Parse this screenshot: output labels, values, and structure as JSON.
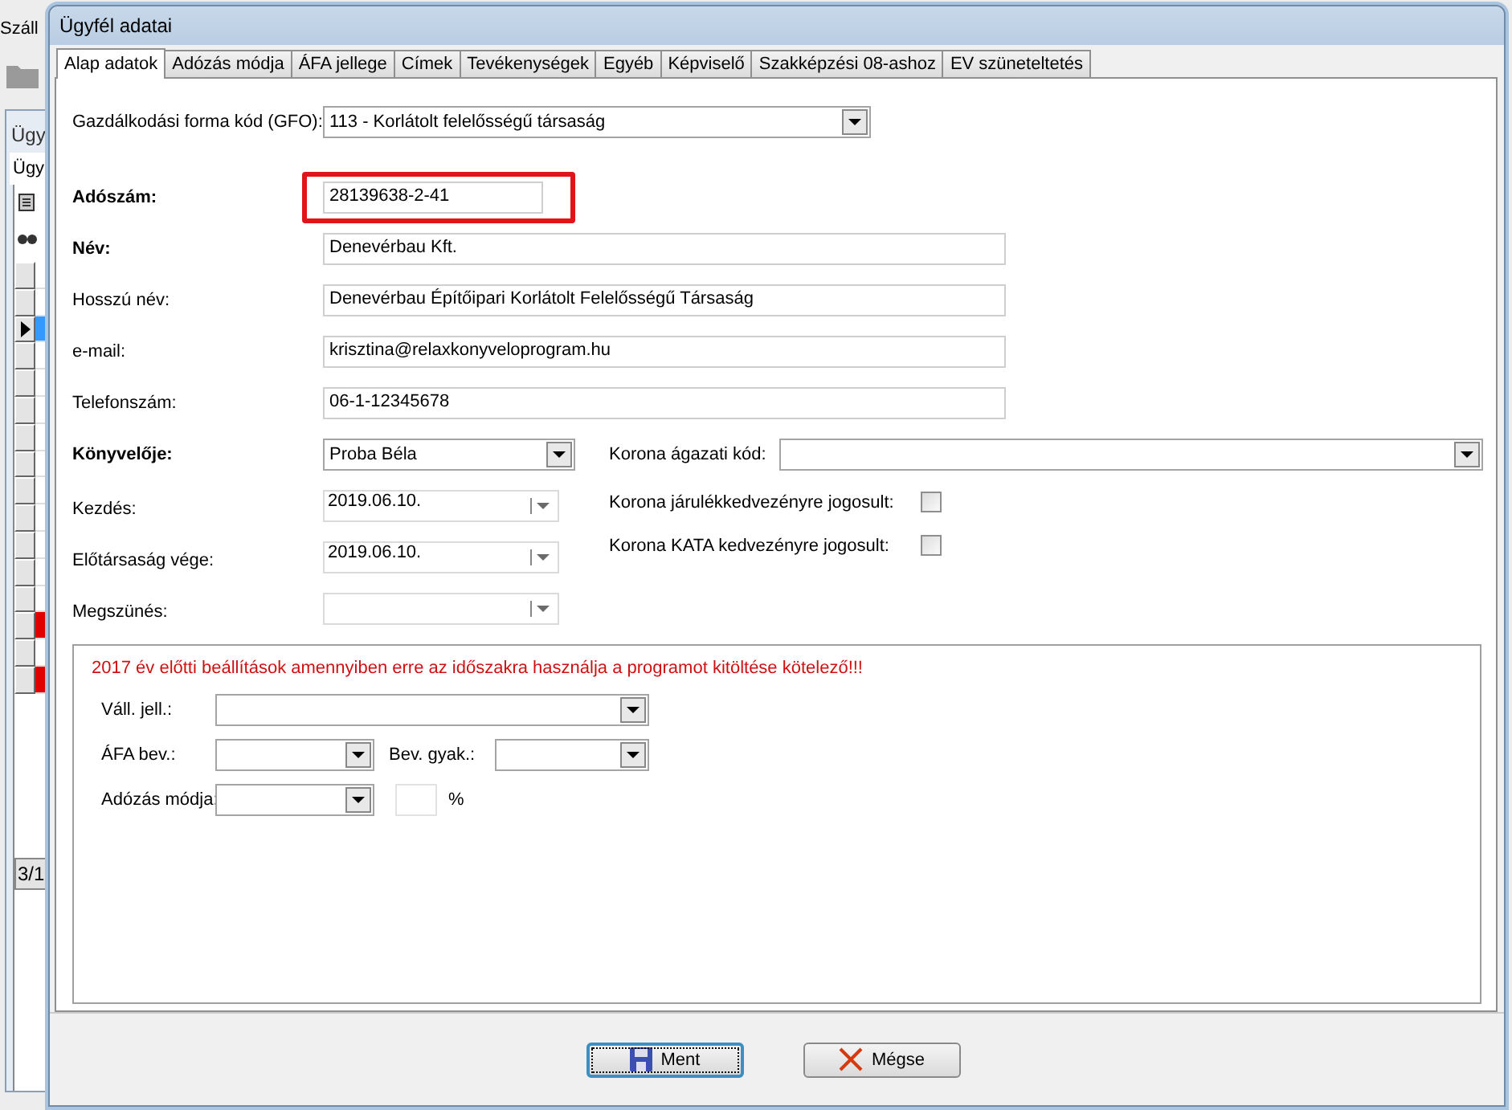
{
  "background_window": {
    "title": "Száll",
    "inner_title": "Ügy",
    "inner_tab": "Ügy",
    "rows": [
      {
        "selected": false,
        "alert": false
      },
      {
        "selected": false,
        "alert": false
      },
      {
        "selected": true,
        "alert": false
      },
      {
        "selected": false,
        "alert": false
      },
      {
        "selected": false,
        "alert": false
      },
      {
        "selected": false,
        "alert": false
      },
      {
        "selected": false,
        "alert": false
      },
      {
        "selected": false,
        "alert": false
      },
      {
        "selected": false,
        "alert": false
      },
      {
        "selected": false,
        "alert": false
      },
      {
        "selected": false,
        "alert": false
      },
      {
        "selected": false,
        "alert": false
      },
      {
        "selected": false,
        "alert": false
      },
      {
        "selected": false,
        "alert": true
      },
      {
        "selected": false,
        "alert": false
      },
      {
        "selected": false,
        "alert": true
      }
    ],
    "pager": "3/1"
  },
  "dialog": {
    "title": "Ügyfél adatai",
    "tabs": [
      {
        "label": "Alap adatok",
        "selected": true
      },
      {
        "label": "Adózás módja",
        "selected": false
      },
      {
        "label": "ÁFA jellege",
        "selected": false
      },
      {
        "label": "Címek",
        "selected": false
      },
      {
        "label": "Tevékenységek",
        "selected": false
      },
      {
        "label": "Egyéb",
        "selected": false
      },
      {
        "label": "Képviselő",
        "selected": false
      },
      {
        "label": "Szakképzési 08-ashoz",
        "selected": false
      },
      {
        "label": "EV szüneteltetés",
        "selected": false
      }
    ],
    "gfo": {
      "label": "Gazdálkodási forma kód (GFO):",
      "value": "113 - Korlátolt felelősségű társaság"
    },
    "fields": [
      {
        "label": "Adószám:",
        "value": "28139638-2-41",
        "bold": true,
        "highlighted": true,
        "kind": "short"
      },
      {
        "label": "Név:",
        "value": "Denevérbau Kft.",
        "bold": true,
        "highlighted": false,
        "kind": "wide"
      },
      {
        "label": "Hosszú név:",
        "value": "Denevérbau Építőipari Korlátolt Felelősségű Társaság",
        "bold": false,
        "highlighted": false,
        "kind": "wide"
      },
      {
        "label": "e-mail:",
        "value": "krisztina@relaxkonyveloprogram.hu",
        "bold": false,
        "highlighted": false,
        "kind": "wide"
      },
      {
        "label": "Telefonszám:",
        "value": "06-1-12345678",
        "bold": false,
        "highlighted": false,
        "kind": "wide"
      }
    ],
    "accountant": {
      "label": "Könyvelője:",
      "value": "Proba Béla"
    },
    "dates": [
      {
        "label": "Kezdés:",
        "value": "2019.06.10."
      },
      {
        "label": "Előtársaság vége:",
        "value": "2019.06.10."
      },
      {
        "label": "Megszünés:"
      }
    ],
    "korona": {
      "code_label": "Korona ágazati kód:",
      "checks": [
        {
          "label": "Korona járulékkedvezényre jogosult:",
          "checked": false
        },
        {
          "label": "Korona KATA kedvezényre jogosult:",
          "checked": false
        }
      ]
    },
    "legacy": {
      "notice": "2017 év előtti beállítások amennyiben erre az időszakra használja a programot kitöltése kötelező!!!",
      "vall_label": "Váll. jell.:",
      "afa_label": "ÁFA bev.:",
      "bev_label": "Bev. gyak.:",
      "adozas_label": "Adózás módja:",
      "percent": "%"
    },
    "buttons": [
      {
        "label": "Ment",
        "kind": "save"
      },
      {
        "label": "Mégse",
        "kind": "cancel"
      }
    ]
  }
}
